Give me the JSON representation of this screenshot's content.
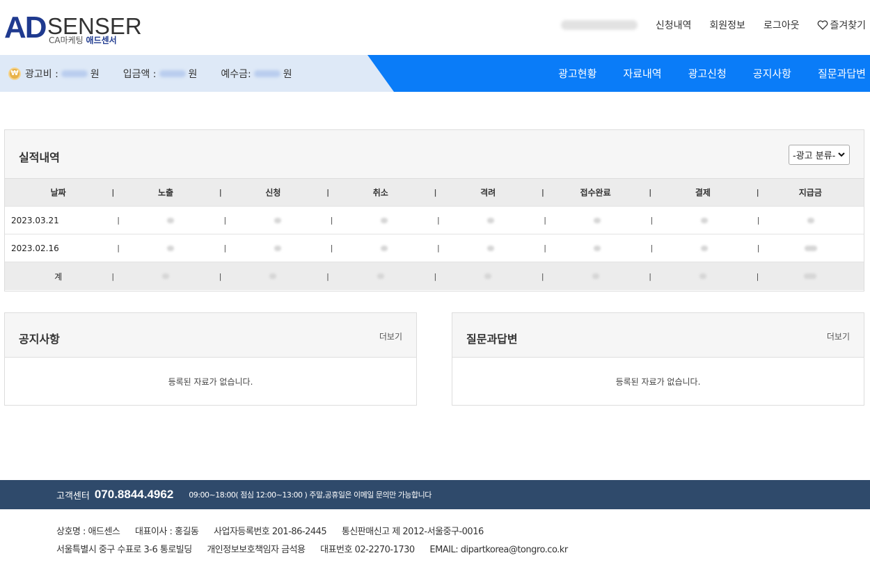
{
  "logo": {
    "brand_ad": "AD",
    "brand_senser": "SENSER",
    "sub_prefix": "CA마케팅",
    "sub_name": "애드센서"
  },
  "top_nav": {
    "items": [
      "신청내역",
      "회원정보",
      "로그아웃"
    ],
    "favorites": "즐겨찾기"
  },
  "balance": {
    "ad_fee_label": "광고비 :",
    "ad_fee_unit": "원",
    "deposit_label": "입금액 :",
    "deposit_unit": "원",
    "reserve_label": "예수금:",
    "reserve_unit": "원",
    "coin_symbol": "₩"
  },
  "main_nav": [
    "광고현황",
    "자료내역",
    "광고신청",
    "공지사항",
    "질문과답변"
  ],
  "performance": {
    "title": "실적내역",
    "filter": "-광고 분류-",
    "columns": [
      "날짜",
      "노출",
      "신청",
      "취소",
      "격려",
      "접수완료",
      "결제",
      "지급금"
    ],
    "rows": [
      {
        "date": "2023.03.21"
      },
      {
        "date": "2023.02.16"
      }
    ],
    "total_label": "계"
  },
  "notice": {
    "title": "공지사항",
    "more": "더보기",
    "empty": "등록된 자료가 없습니다."
  },
  "qna": {
    "title": "질문과답변",
    "more": "더보기",
    "empty": "등록된 자료가 없습니다."
  },
  "footer": {
    "cs_label": "고객센터",
    "cs_phone": "070.8844.4962",
    "cs_hours": "09:00~18:00( 점심 12:00~13:00 ) 주말,공휴일은 이메일 문의만 가능합니다",
    "line1": [
      "상호명 : 애드센스",
      "대표이사 : 홍길동",
      "사업자등록번호 201-86-2445",
      "통신판매신고 제 2012-서울중구-0016"
    ],
    "line2": [
      "서울특별시 중구 수표로 3-6 통로빌딩",
      "개인정보보호책임자 금석용",
      "대표번호 02-2270-1730",
      "EMAIL: dipartkorea@tongro.co.kr"
    ]
  }
}
